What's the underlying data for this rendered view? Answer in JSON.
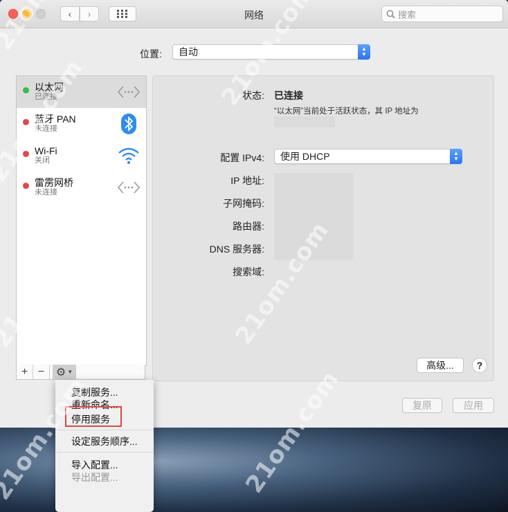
{
  "window": {
    "title": "网络",
    "search_placeholder": "搜索"
  },
  "location": {
    "label": "位置:",
    "value": "自动"
  },
  "services": [
    {
      "name": "以太网",
      "status": "已连接",
      "state": "green",
      "icon": "ethernet-icon"
    },
    {
      "name": "蓝牙 PAN",
      "status": "未连接",
      "state": "red",
      "icon": "bluetooth-icon"
    },
    {
      "name": "Wi-Fi",
      "status": "关闭",
      "state": "red",
      "icon": "wifi-icon"
    },
    {
      "name": "雷雳网桥",
      "status": "未连接",
      "state": "red",
      "icon": "ethernet-icon"
    }
  ],
  "toolbar": {
    "add": "+",
    "remove": "−",
    "gear": "⚙"
  },
  "detail": {
    "status_label": "状态:",
    "status_value": "已连接",
    "status_desc": "“以太网”当前处于活跃状态，其 IP 地址为",
    "config_label": "配置 IPv4:",
    "config_value": "使用 DHCP",
    "ip_label": "IP 地址:",
    "subnet_label": "子网掩码:",
    "router_label": "路由器:",
    "dns_label": "DNS 服务器:",
    "search_domain_label": "搜索域:",
    "advanced_button": "高级...",
    "help_button": "?"
  },
  "footer": {
    "revert": "复原",
    "apply": "应用"
  },
  "gear_menu": {
    "items": [
      "复制服务...",
      "重新命名...",
      "停用服务",
      "设定服务顺序...",
      "导入配置...",
      "导出配置..."
    ],
    "highlighted": "停用服务"
  },
  "colors": {
    "connected": "#37c03c",
    "disconnected": "#e4464b",
    "accent": "#2a74ef",
    "highlight_box": "#e2463f"
  },
  "watermark_text": "21om.com"
}
